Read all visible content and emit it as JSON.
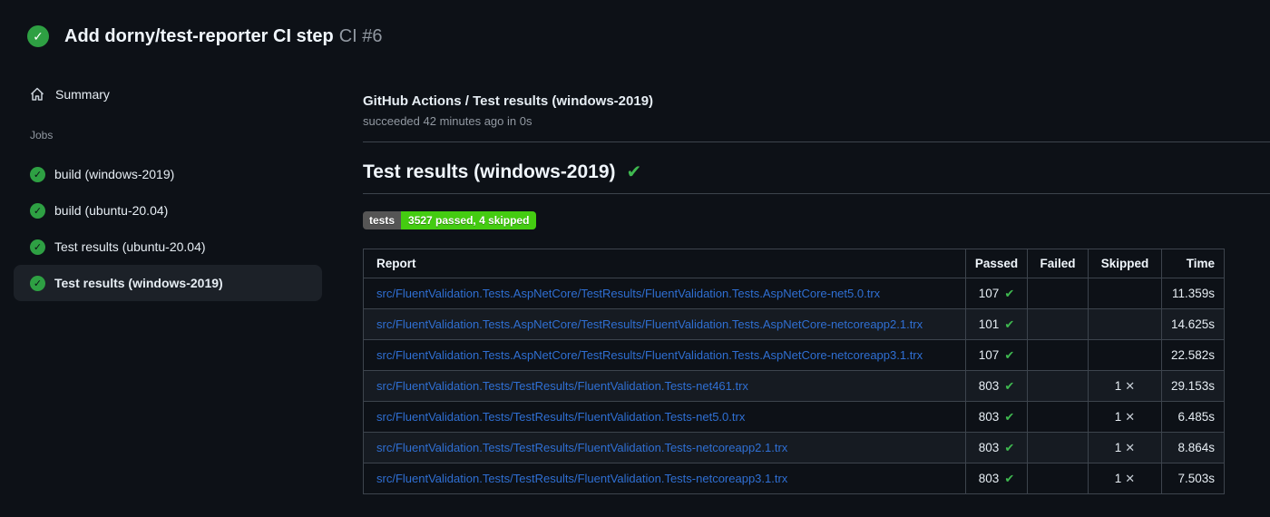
{
  "icons": {
    "check": "✓",
    "heavy_check": "✔",
    "cross": "✕"
  },
  "colors": {
    "page_bg": "#0d1117",
    "success_green": "#2ea043",
    "check_green": "#3fb950",
    "link_blue": "#2f6fd3",
    "badge_label_bg": "#555555",
    "badge_value_bg": "#44cc11",
    "selected_job_bg": "#1c2128",
    "border": "#3d444d"
  },
  "run_header": {
    "title": "Add dorny/test-reporter CI step",
    "run_ref": "CI #6"
  },
  "sidebar": {
    "summary_label": "Summary",
    "jobs_label": "Jobs",
    "jobs": [
      {
        "label": "build (windows-2019)",
        "selected": false
      },
      {
        "label": "build (ubuntu-20.04)",
        "selected": false
      },
      {
        "label": "Test results (ubuntu-20.04)",
        "selected": false
      },
      {
        "label": "Test results (windows-2019)",
        "selected": true
      }
    ]
  },
  "main": {
    "check_title": "GitHub Actions / Test results (windows-2019)",
    "check_status": "succeeded 42 minutes ago in 0s",
    "section_heading": "Test results (windows-2019)",
    "badge": {
      "label": "tests",
      "value": "3527 passed, 4 skipped"
    },
    "table": {
      "headers": [
        "Report",
        "Passed",
        "Failed",
        "Skipped",
        "Time"
      ],
      "rows": [
        {
          "report": "src/FluentValidation.Tests.AspNetCore/TestResults/FluentValidation.Tests.AspNetCore-net5.0.trx",
          "passed": "107",
          "failed": "",
          "skipped": "",
          "time": "11.359s"
        },
        {
          "report": "src/FluentValidation.Tests.AspNetCore/TestResults/FluentValidation.Tests.AspNetCore-netcoreapp2.1.trx",
          "passed": "101",
          "failed": "",
          "skipped": "",
          "time": "14.625s"
        },
        {
          "report": "src/FluentValidation.Tests.AspNetCore/TestResults/FluentValidation.Tests.AspNetCore-netcoreapp3.1.trx",
          "passed": "107",
          "failed": "",
          "skipped": "",
          "time": "22.582s"
        },
        {
          "report": "src/FluentValidation.Tests/TestResults/FluentValidation.Tests-net461.trx",
          "passed": "803",
          "failed": "",
          "skipped": "1",
          "time": "29.153s"
        },
        {
          "report": "src/FluentValidation.Tests/TestResults/FluentValidation.Tests-net5.0.trx",
          "passed": "803",
          "failed": "",
          "skipped": "1",
          "time": "6.485s"
        },
        {
          "report": "src/FluentValidation.Tests/TestResults/FluentValidation.Tests-netcoreapp2.1.trx",
          "passed": "803",
          "failed": "",
          "skipped": "1",
          "time": "8.864s"
        },
        {
          "report": "src/FluentValidation.Tests/TestResults/FluentValidation.Tests-netcoreapp3.1.trx",
          "passed": "803",
          "failed": "",
          "skipped": "1",
          "time": "7.503s"
        }
      ]
    }
  }
}
